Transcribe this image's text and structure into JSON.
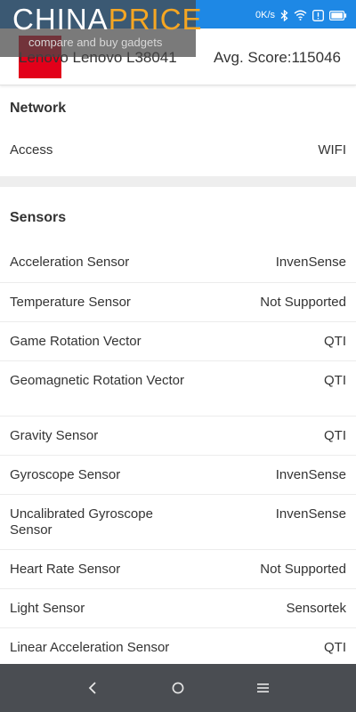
{
  "watermark": {
    "logo_part1": "CHINA",
    "logo_part2": "PRICE",
    "tagline": "compare and buy gadgets"
  },
  "status_bar": {
    "speed": "0K/s"
  },
  "header": {
    "device_name": "Lenovo Lenovo L38041",
    "avg_score": "Avg. Score:115046"
  },
  "network": {
    "title": "Network",
    "rows": [
      {
        "label": "Access",
        "value": "WIFI"
      }
    ]
  },
  "sensors": {
    "title": "Sensors",
    "rows": [
      {
        "label": "Acceleration Sensor",
        "value": "InvenSense"
      },
      {
        "label": "Temperature Sensor",
        "value": "Not Supported"
      },
      {
        "label": "Game Rotation Vector",
        "value": "QTI"
      },
      {
        "label": "Geomagnetic Rotation Vector",
        "value": "QTI"
      },
      {
        "label": "Gravity Sensor",
        "value": "QTI"
      },
      {
        "label": "Gyroscope Sensor",
        "value": "InvenSense"
      },
      {
        "label": "Uncalibrated Gyroscope Sensor",
        "value": "InvenSense"
      },
      {
        "label": "Heart Rate Sensor",
        "value": "Not Supported"
      },
      {
        "label": "Light Sensor",
        "value": "Sensortek"
      },
      {
        "label": "Linear Acceleration Sensor",
        "value": "QTI"
      }
    ]
  },
  "colors": {
    "status_bar": "#1e88e5",
    "brand": "#e2001a",
    "nav_bar": "#4a4d52",
    "watermark_accent": "#f5a623"
  },
  "icons": {
    "back": "back-icon",
    "home": "home-icon",
    "recents": "recents-icon"
  }
}
